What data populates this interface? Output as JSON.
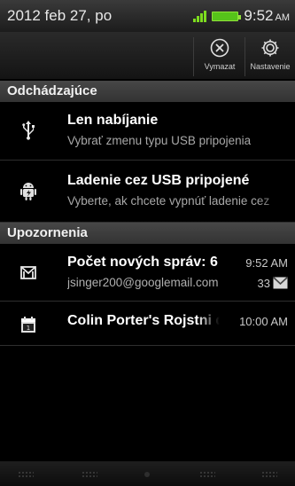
{
  "status_bar": {
    "date": "2012 feb 27, po",
    "time": "9:52",
    "ampm": "AM",
    "signal_color": "#7ddc1f",
    "battery_color": "#56c31a"
  },
  "actions": {
    "clear": {
      "label": "Vymazat",
      "icon": "clear-x-icon"
    },
    "settings": {
      "label": "Nastavenie",
      "icon": "gear-icon"
    }
  },
  "sections": {
    "ongoing": {
      "title": "Odchádzajúce"
    },
    "notifications": {
      "title": "Upozornenia"
    }
  },
  "ongoing_items": [
    {
      "icon": "usb-icon",
      "title": "Len nabíjanie",
      "subtitle": "Vybrať zmenu typu USB pripojenia"
    },
    {
      "icon": "android-debug-icon",
      "title": "Ladenie cez USB pripojené",
      "subtitle": "Vyberte, ak chcete vypnúť ladenie cez"
    }
  ],
  "notification_items": [
    {
      "icon": "gmail-icon",
      "title": "Počet nových správ: 6",
      "subtitle": "jsinger200@googlemail.com",
      "time": "9:52 AM",
      "count": "33"
    },
    {
      "icon": "calendar-icon",
      "title": "Colin Porter's Rojstni dan",
      "time": "10:00 AM"
    }
  ]
}
